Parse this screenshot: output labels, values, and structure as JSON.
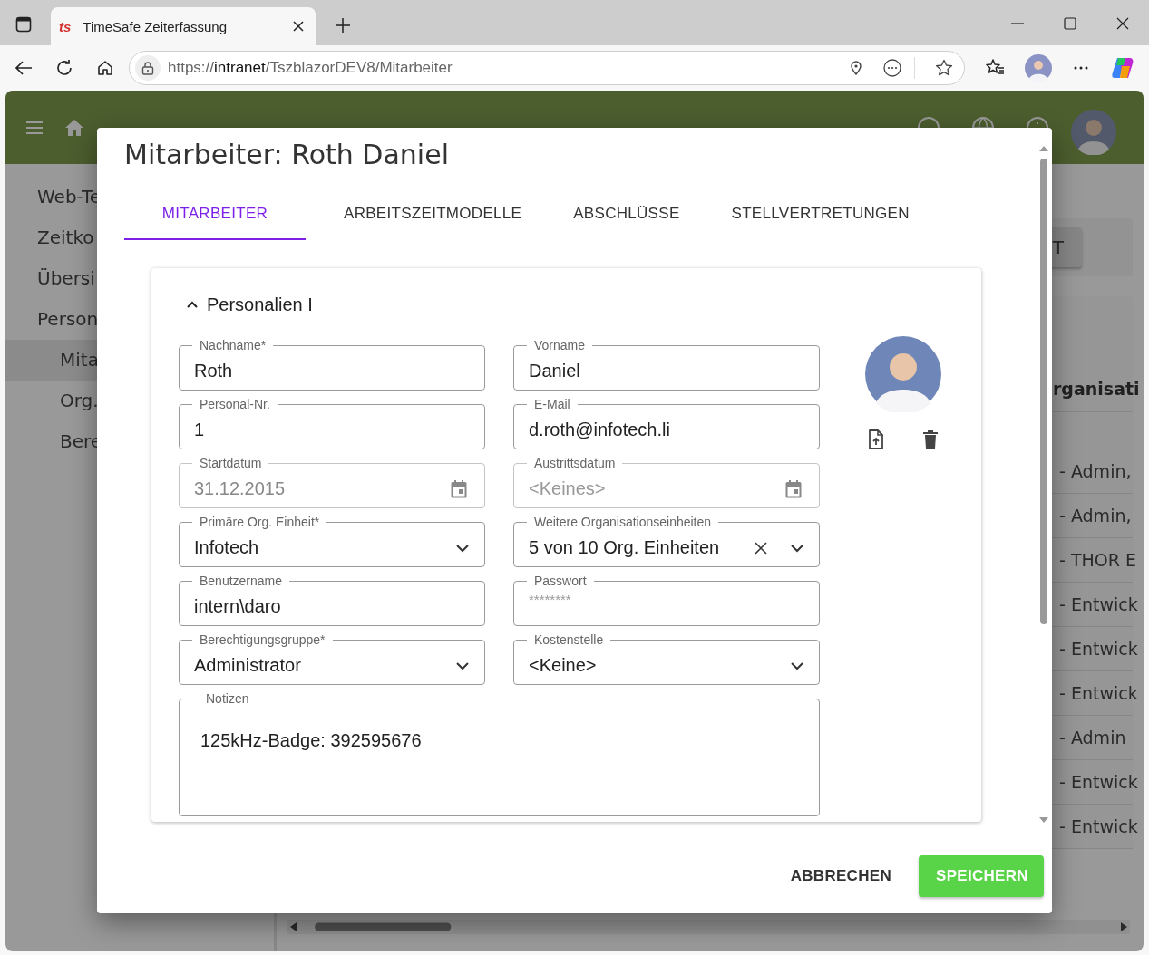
{
  "browser": {
    "tab": {
      "favicon_text": "ts",
      "title": "TimeSafe Zeiterfassung"
    },
    "url": {
      "scheme": "https://",
      "host": "intranet",
      "path": "/TszblazorDEV8/Mitarbeiter"
    }
  },
  "app": {
    "sidebar": {
      "items": [
        {
          "label": "Web-Te",
          "selected": false
        },
        {
          "label": "Zeitko",
          "selected": false
        },
        {
          "label": "Übersi",
          "selected": false
        },
        {
          "label": "Person",
          "selected": false,
          "children": [
            {
              "label": "Mita",
              "selected": true
            },
            {
              "label": "Org.",
              "selected": false
            },
            {
              "label": "Bere",
              "selected": false
            }
          ]
        }
      ]
    },
    "toolbar_button": "T",
    "table": {
      "column_header": "rganisati",
      "rows": [
        "- Admin,",
        "- Admin,",
        "- THOR E",
        "- Entwick",
        "- Entwick",
        "- Entwick",
        "- Admin",
        "- Entwick",
        "- Entwick"
      ]
    }
  },
  "dialog": {
    "title": "Mitarbeiter: Roth Daniel",
    "tabs": [
      {
        "label": "MITARBEITER",
        "selected": true
      },
      {
        "label": "ARBEITSZEITMODELLE",
        "selected": false
      },
      {
        "label": "ABSCHLÜSSE",
        "selected": false
      },
      {
        "label": "STELLVERTRETUNGEN",
        "selected": false
      }
    ],
    "section": {
      "title": "Personalien I",
      "expanded": true
    },
    "fields": [
      {
        "label": "Nachname*",
        "value": "Roth",
        "kind": "text",
        "disabled": false
      },
      {
        "label": "Vorname",
        "value": "Daniel",
        "kind": "text",
        "disabled": false
      },
      {
        "label": "Personal-Nr.",
        "value": "1",
        "kind": "text",
        "disabled": false
      },
      {
        "label": "E-Mail",
        "value": "d.roth@infotech.li",
        "kind": "text",
        "disabled": false
      },
      {
        "label": "Startdatum",
        "value": "31.12.2015",
        "kind": "date",
        "disabled": true
      },
      {
        "label": "Austrittsdatum",
        "placeholder": "<Keines>",
        "kind": "date",
        "disabled": true
      },
      {
        "label": "Primäre Org. Einheit*",
        "value": "Infotech",
        "kind": "select",
        "disabled": false
      },
      {
        "label": "Weitere Organisationseinheiten",
        "value": "5 von 10 Org. Einheiten",
        "kind": "multiselect",
        "disabled": false
      },
      {
        "label": "Benutzername",
        "value": "intern\\daro",
        "kind": "text",
        "disabled": false
      },
      {
        "label": "Passwort",
        "placeholder": "********",
        "kind": "password",
        "disabled": false
      },
      {
        "label": "Berechtigungsgruppe*",
        "value": "Administrator",
        "kind": "select",
        "disabled": false
      },
      {
        "label": "Kostenstelle",
        "value": "<Keine>",
        "kind": "select",
        "disabled": false
      }
    ],
    "notes": {
      "label": "Notizen",
      "value": "125kHz-Badge: 392595676"
    },
    "buttons": [
      {
        "label": "ABBRECHEN",
        "kind": "text"
      },
      {
        "label": "SPEICHERN",
        "kind": "primary"
      }
    ]
  }
}
